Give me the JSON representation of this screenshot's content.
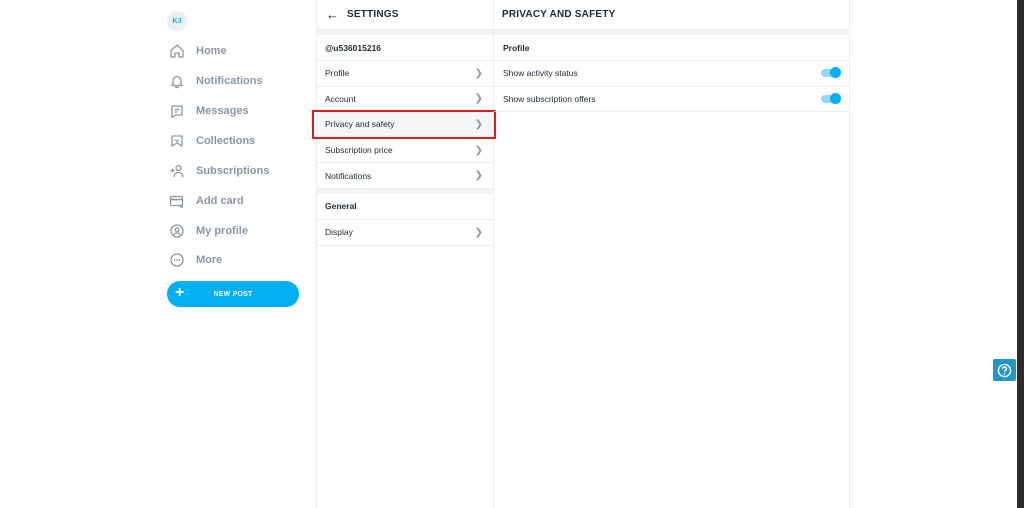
{
  "nav": {
    "avatar_initials": "KJ",
    "items": [
      {
        "label": "Home",
        "icon": "home-icon"
      },
      {
        "label": "Notifications",
        "icon": "bell-icon"
      },
      {
        "label": "Messages",
        "icon": "message-icon"
      },
      {
        "label": "Collections",
        "icon": "collections-icon"
      },
      {
        "label": "Subscriptions",
        "icon": "subscriptions-icon"
      },
      {
        "label": "Add card",
        "icon": "card-icon"
      },
      {
        "label": "My profile",
        "icon": "profile-icon"
      },
      {
        "label": "More",
        "icon": "more-icon"
      }
    ],
    "new_post_label": "NEW POST"
  },
  "settings": {
    "title": "SETTINGS",
    "username": "@u536015216",
    "items": [
      {
        "label": "Profile"
      },
      {
        "label": "Account"
      },
      {
        "label": "Privacy and safety"
      },
      {
        "label": "Subscription price"
      },
      {
        "label": "Notifications"
      }
    ],
    "general_label": "General",
    "general_items": [
      {
        "label": "Display"
      }
    ]
  },
  "privacy": {
    "title": "PRIVACY AND SAFETY",
    "section_label": "Profile",
    "toggles": [
      {
        "label": "Show activity status",
        "enabled": true
      },
      {
        "label": "Show subscription offers",
        "enabled": true
      }
    ]
  },
  "colors": {
    "accent": "#00aff0",
    "highlight_box": "#e01b1b",
    "help_button": "#2196c9"
  }
}
